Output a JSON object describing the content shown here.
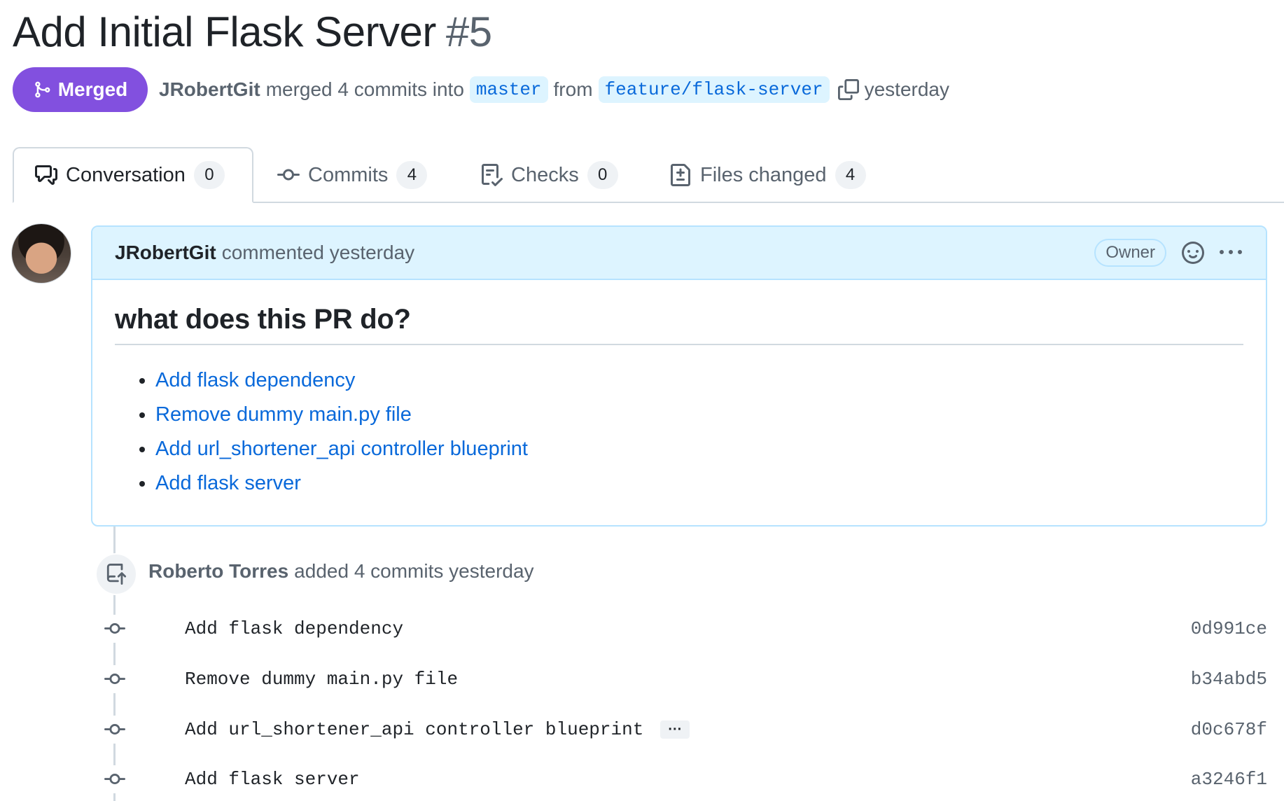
{
  "pr": {
    "title": "Add Initial Flask Server",
    "number": "#5",
    "state": "Merged",
    "author": "JRobertGit",
    "merged_text": "merged 4 commits into",
    "base_branch": "master",
    "from_text": "from",
    "head_branch": "feature/flask-server",
    "time": "yesterday"
  },
  "tabs": [
    {
      "label": "Conversation",
      "count": "0",
      "icon": "comment-discussion-icon"
    },
    {
      "label": "Commits",
      "count": "4",
      "icon": "git-commit-icon"
    },
    {
      "label": "Checks",
      "count": "0",
      "icon": "checklist-icon"
    },
    {
      "label": "Files changed",
      "count": "4",
      "icon": "file-diff-icon"
    }
  ],
  "comment": {
    "author": "JRobertGit",
    "action": "commented yesterday",
    "role_badge": "Owner",
    "heading": "what does this PR do?",
    "items": [
      "Add flask dependency",
      "Remove dummy main.py file",
      "Add url_shortener_api controller blueprint",
      "Add flask server"
    ]
  },
  "timeline": {
    "push_author": "Roberto Torres",
    "push_text": "added 4 commits yesterday",
    "commits": [
      {
        "message": "Add flask dependency",
        "sha": "0d991ce"
      },
      {
        "message": "Remove dummy main.py file",
        "sha": "b34abd5"
      },
      {
        "message": "Add url_shortener_api controller blueprint",
        "sha": "d0c678f",
        "more": "···"
      },
      {
        "message": "Add flask server",
        "sha": "a3246f1"
      }
    ]
  },
  "colors": {
    "merged": "#8250df",
    "link": "#0969da",
    "comment_header_bg": "#ddf4ff",
    "muted_text": "#59636e"
  }
}
